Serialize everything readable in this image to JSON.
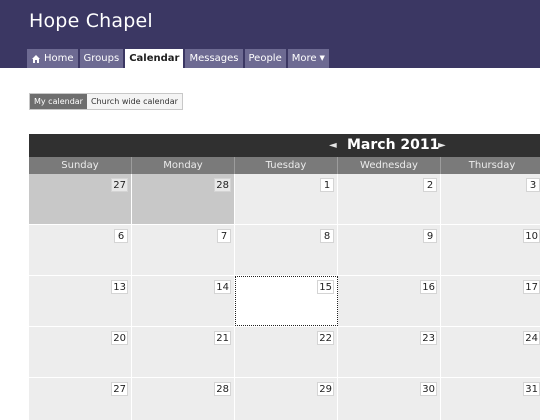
{
  "header": {
    "site_title": "Hope Chapel",
    "nav": [
      {
        "label": "Home",
        "icon": "home-icon",
        "active": false
      },
      {
        "label": "Groups",
        "active": false
      },
      {
        "label": "Calendar",
        "active": true
      },
      {
        "label": "Messages",
        "active": false
      },
      {
        "label": "People",
        "active": false
      },
      {
        "label": "More",
        "icon": "caret-down-icon",
        "active": false
      }
    ]
  },
  "view_toggle": {
    "my_calendar": "My calendar",
    "church_wide": "Church wide calendar",
    "selected": "My calendar"
  },
  "calendar": {
    "month_label": "March 2011",
    "prev_icon": "◄",
    "next_icon": "►",
    "day_names": [
      "Sunday",
      "Monday",
      "Tuesday",
      "Wednesday",
      "Thursday"
    ],
    "today": "15",
    "weeks": [
      [
        {
          "num": "27",
          "other_month": true
        },
        {
          "num": "28",
          "other_month": true
        },
        {
          "num": "1"
        },
        {
          "num": "2"
        },
        {
          "num": "3"
        }
      ],
      [
        {
          "num": "6"
        },
        {
          "num": "7"
        },
        {
          "num": "8"
        },
        {
          "num": "9"
        },
        {
          "num": "10"
        }
      ],
      [
        {
          "num": "13"
        },
        {
          "num": "14"
        },
        {
          "num": "15",
          "today": true
        },
        {
          "num": "16"
        },
        {
          "num": "17"
        }
      ],
      [
        {
          "num": "20"
        },
        {
          "num": "21"
        },
        {
          "num": "22"
        },
        {
          "num": "23"
        },
        {
          "num": "24"
        }
      ],
      [
        {
          "num": "27"
        },
        {
          "num": "28"
        },
        {
          "num": "29"
        },
        {
          "num": "30"
        },
        {
          "num": "31"
        }
      ]
    ]
  },
  "colors": {
    "header_bg": "#3b3763",
    "nav_tab_bg": "#6d6a92",
    "calendar_bar": "#303030",
    "day_header_bg": "#7a7a7a",
    "cell_bg": "#ededed",
    "other_month_bg": "#c8c8c8"
  }
}
